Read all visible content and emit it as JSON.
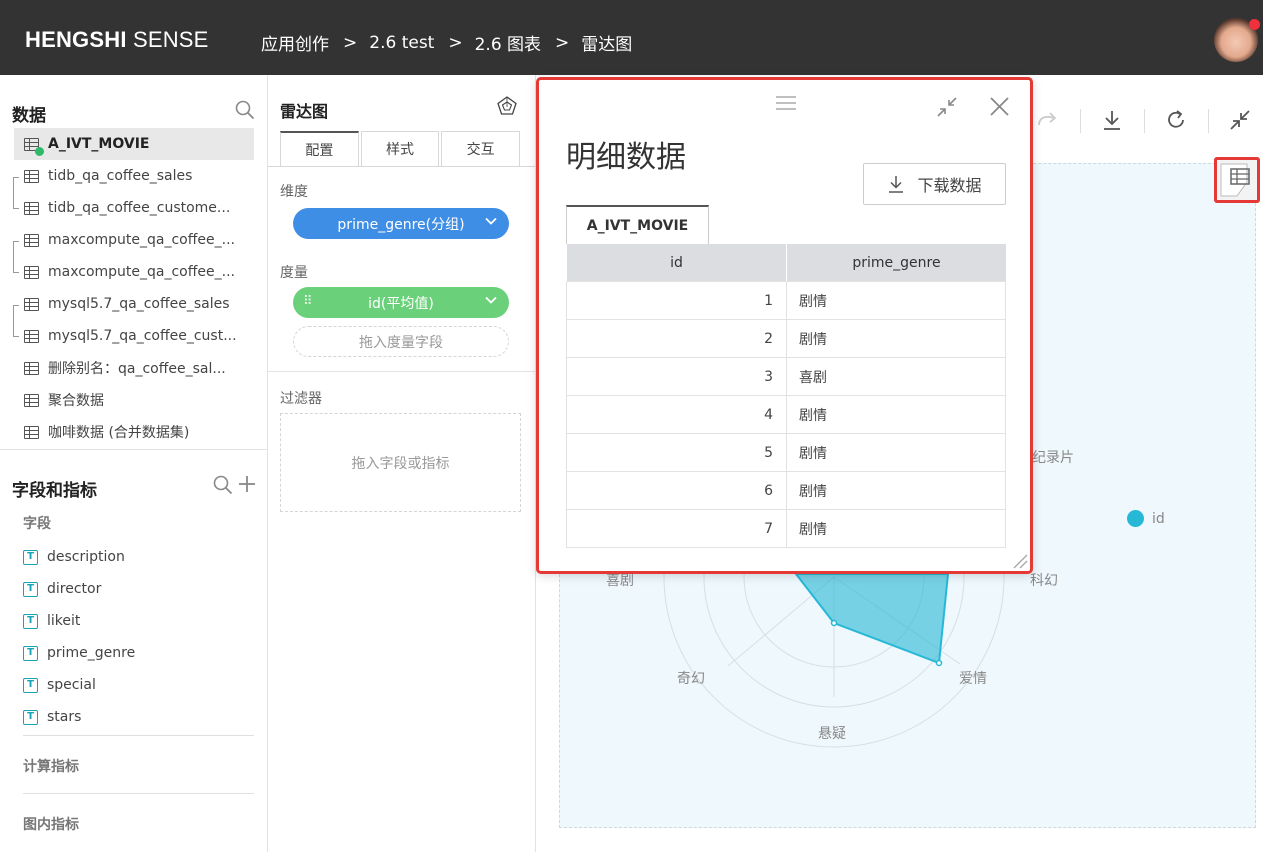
{
  "header": {
    "brand_bold": "HENGSHI",
    "brand_rest": " SENSE",
    "breadcrumbs": [
      "应用创作",
      "2.6 test",
      "2.6 图表",
      "雷达图"
    ],
    "separator": ">"
  },
  "data_panel": {
    "title": "数据",
    "datasets": [
      "A_IVT_MOVIE",
      "tidb_qa_coffee_sales",
      "tidb_qa_coffee_custome...",
      "maxcompute_qa_coffee_...",
      "maxcompute_qa_coffee_...",
      "mysql5.7_qa_coffee_sales",
      "mysql5.7_qa_coffee_cust...",
      "删除别名：qa_coffee_sal...",
      "聚合数据",
      "咖啡数据 (合并数据集)"
    ]
  },
  "fields_panel": {
    "title": "字段和指标",
    "fields_label": "字段",
    "fields": [
      "description",
      "director",
      "likeit",
      "prime_genre",
      "special",
      "stars"
    ],
    "field_type_glyph": "T",
    "calc_label": "计算指标",
    "chart_metrics_label": "图内指标"
  },
  "config": {
    "title": "雷达图",
    "tabs": [
      "配置",
      "样式",
      "交互"
    ],
    "dimension_label": "维度",
    "dimension_pill": "prime_genre(分组)",
    "measure_label": "度量",
    "measure_pill": "id(平均值)",
    "measure_drop": "拖入度量字段",
    "filter_label": "过滤器",
    "filter_drop": "拖入字段或指标"
  },
  "chart": {
    "labels": {
      "top_right": "纪录片",
      "right": "科幻",
      "bottom_right": "爱情",
      "bottom": "悬疑",
      "bottom_left": "奇幻",
      "left": "喜剧"
    },
    "legend": "id",
    "series_color": "#26b8d6"
  },
  "modal": {
    "title": "明细数据",
    "download_label": "下载数据",
    "tab": "A_IVT_MOVIE",
    "columns": [
      "id",
      "prime_genre"
    ],
    "rows": [
      [
        "1",
        "剧情"
      ],
      [
        "2",
        "剧情"
      ],
      [
        "3",
        "喜剧"
      ],
      [
        "4",
        "剧情"
      ],
      [
        "5",
        "剧情"
      ],
      [
        "6",
        "剧情"
      ],
      [
        "7",
        "剧情"
      ]
    ]
  },
  "colors": {
    "highlight": "#e53935",
    "dimension": "#3f8ee6",
    "measure": "#6bd07a"
  }
}
